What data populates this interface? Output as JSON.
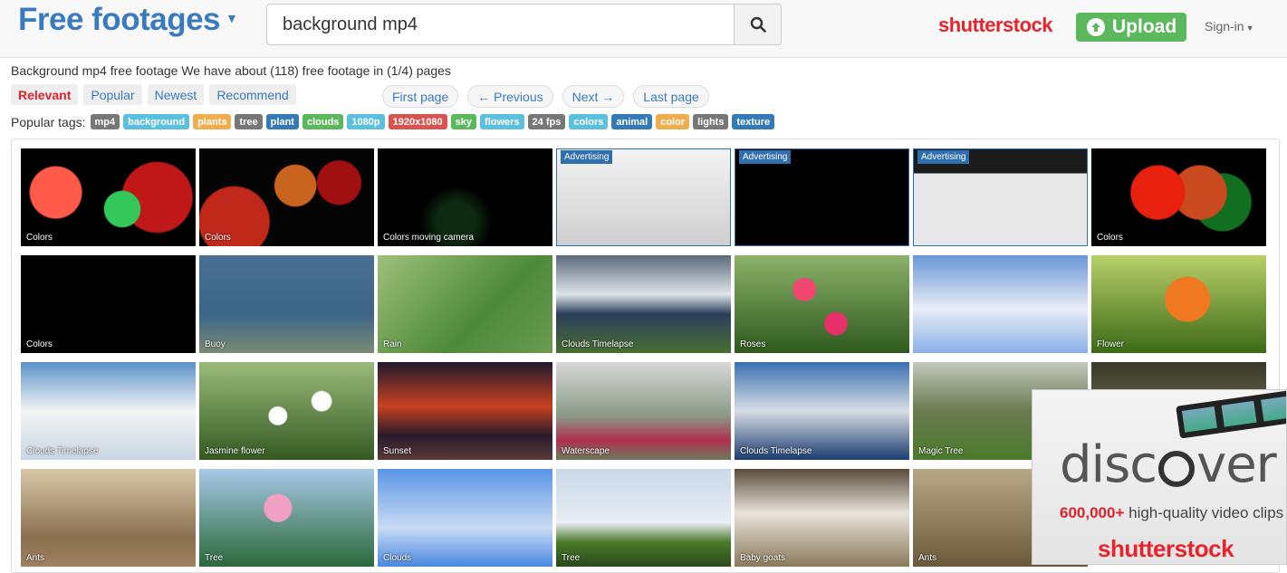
{
  "header": {
    "logo": "Free footages",
    "search_value": "background mp4",
    "search_placeholder": "",
    "partner_logo": "shutterstock",
    "upload_label": "Upload",
    "signin_label": "Sign-in"
  },
  "summary": "Background mp4 free footage We have about (118) free footage in (1/4) pages",
  "sort_tabs": [
    "Relevant",
    "Popular",
    "Newest",
    "Recommend"
  ],
  "pager": [
    "First page",
    "← Previous",
    "Next →",
    "Last page"
  ],
  "tags_label": "Popular tags:",
  "tags": [
    {
      "label": "mp4",
      "color": "#777777"
    },
    {
      "label": "background",
      "color": "#5bc0de"
    },
    {
      "label": "plants",
      "color": "#f0ad4e"
    },
    {
      "label": "tree",
      "color": "#777777"
    },
    {
      "label": "plant",
      "color": "#337ab7"
    },
    {
      "label": "clouds",
      "color": "#5cb85c"
    },
    {
      "label": "1080p",
      "color": "#5bc0de"
    },
    {
      "label": "1920x1080",
      "color": "#d9534f"
    },
    {
      "label": "sky",
      "color": "#5cb85c"
    },
    {
      "label": "flowers",
      "color": "#5bc0de"
    },
    {
      "label": "24 fps",
      "color": "#777777"
    },
    {
      "label": "colors",
      "color": "#5bc0de"
    },
    {
      "label": "animal",
      "color": "#337ab7"
    },
    {
      "label": "color",
      "color": "#f0ad4e"
    },
    {
      "label": "lights",
      "color": "#777777"
    },
    {
      "label": "texture",
      "color": "#337ab7"
    }
  ],
  "ad_label": "Advertising",
  "thumbnails": [
    {
      "caption": "Colors",
      "ad": false
    },
    {
      "caption": "Colors",
      "ad": false
    },
    {
      "caption": "Colors moving camera",
      "ad": false
    },
    {
      "caption": "",
      "ad": true
    },
    {
      "caption": "",
      "ad": true
    },
    {
      "caption": "",
      "ad": true
    },
    {
      "caption": "Colors",
      "ad": false
    },
    {
      "caption": "Colors",
      "ad": false
    },
    {
      "caption": "Buoy",
      "ad": false
    },
    {
      "caption": "Rain",
      "ad": false
    },
    {
      "caption": "Clouds Timelapse",
      "ad": false
    },
    {
      "caption": "Roses",
      "ad": false
    },
    {
      "caption": "",
      "ad": false
    },
    {
      "caption": "Flower",
      "ad": false
    },
    {
      "caption": "Clouds Timelapse",
      "ad": false
    },
    {
      "caption": "Jasmine flower",
      "ad": false
    },
    {
      "caption": "Sunset",
      "ad": false
    },
    {
      "caption": "Waterscape",
      "ad": false
    },
    {
      "caption": "Clouds Timelapse",
      "ad": false
    },
    {
      "caption": "Magic Tree",
      "ad": false
    },
    {
      "caption": "",
      "ad": false
    },
    {
      "caption": "Ants",
      "ad": false
    },
    {
      "caption": "Tree",
      "ad": false
    },
    {
      "caption": "Clouds",
      "ad": false
    },
    {
      "caption": "Tree",
      "ad": false
    },
    {
      "caption": "Baby goats",
      "ad": false
    },
    {
      "caption": "Ants",
      "ad": false
    }
  ],
  "ad_banner": {
    "word": "disc ver",
    "count": "600,000+",
    "tagline": "high-quality video clips",
    "brand": "shutterstock"
  }
}
